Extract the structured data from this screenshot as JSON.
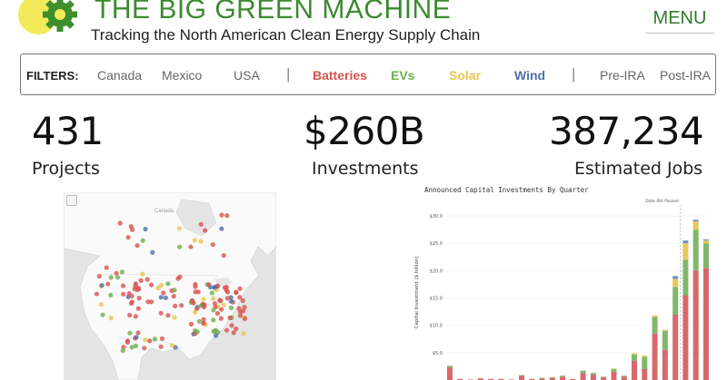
{
  "brand": {
    "title": "THE BIG GREEN MACHINE",
    "tagline": "Tracking the North American Clean Energy Supply Chain",
    "logo_icon": "gear-leaf-icon",
    "logo_colors": {
      "sun": "#f2ea5a",
      "gear": "#3e8f2c"
    }
  },
  "menu": {
    "label": "MENU"
  },
  "filters": {
    "label": "FILTERS:",
    "regions": [
      "Canada",
      "Mexico",
      "USA"
    ],
    "sectors": [
      {
        "label": "Batteries",
        "color": "#d9534f"
      },
      {
        "label": "EVs",
        "color": "#6ab04c"
      },
      {
        "label": "Solar",
        "color": "#eac651"
      },
      {
        "label": "Wind",
        "color": "#4f6fa8"
      }
    ],
    "periods": [
      "Pre-IRA",
      "Post-IRA"
    ],
    "separator": "|"
  },
  "stats": [
    {
      "value": "431",
      "label": "Projects"
    },
    {
      "value": "$260B",
      "label": "Investments"
    },
    {
      "value": "387,234",
      "label": "Estimated Jobs"
    }
  ],
  "map": {
    "region_label": "Canada",
    "zoom_icon": "search-icon"
  },
  "chart_data": {
    "type": "bar",
    "title": "Announced Capital Investments By Quarter",
    "ylabel": "Capital Investment ($ billion)",
    "y_ticks": [
      "$30.0",
      "$25.0",
      "$20.0",
      "$15.0",
      "$10.0",
      "$5.0"
    ],
    "ylim": [
      0,
      32
    ],
    "annotation": "Date IRA Passed",
    "stacked": true,
    "series": [
      {
        "name": "Batteries",
        "color": "#d9686a"
      },
      {
        "name": "EVs",
        "color": "#7fb86a"
      },
      {
        "name": "Solar",
        "color": "#e8c85a"
      },
      {
        "name": "Wind",
        "color": "#6a8fc0"
      }
    ],
    "bars": [
      {
        "q": 1,
        "values": [
          2.3,
          0.3,
          0,
          0
        ]
      },
      {
        "q": 2,
        "values": [
          0.2,
          0,
          0,
          0
        ]
      },
      {
        "q": 3,
        "values": [
          0.1,
          0,
          0,
          0
        ]
      },
      {
        "q": 4,
        "values": [
          0.3,
          0,
          0,
          0
        ]
      },
      {
        "q": 5,
        "values": [
          0.2,
          0,
          0,
          0
        ]
      },
      {
        "q": 6,
        "values": [
          0.2,
          0,
          0,
          0
        ]
      },
      {
        "q": 7,
        "values": [
          0.1,
          0,
          0,
          0
        ]
      },
      {
        "q": 8,
        "values": [
          0.8,
          0.1,
          0,
          0
        ]
      },
      {
        "q": 9,
        "values": [
          0.2,
          0,
          0,
          0
        ]
      },
      {
        "q": 10,
        "values": [
          0.3,
          0.1,
          0,
          0
        ]
      },
      {
        "q": 11,
        "values": [
          0.4,
          0.1,
          0,
          0
        ]
      },
      {
        "q": 12,
        "values": [
          0.6,
          0.2,
          0,
          0
        ]
      },
      {
        "q": 13,
        "values": [
          0.2,
          0,
          0,
          0
        ]
      },
      {
        "q": 14,
        "values": [
          1.3,
          0.4,
          0,
          0
        ]
      },
      {
        "q": 15,
        "values": [
          1.0,
          0.3,
          0,
          0
        ]
      },
      {
        "q": 16,
        "values": [
          0.5,
          0.1,
          0,
          0
        ]
      },
      {
        "q": 17,
        "values": [
          1.5,
          0.5,
          0.1,
          0
        ]
      },
      {
        "q": 18,
        "values": [
          0.6,
          0.2,
          0,
          0
        ]
      },
      {
        "q": 19,
        "values": [
          3.5,
          1.2,
          0.2,
          0
        ]
      },
      {
        "q": 20,
        "values": [
          2.0,
          2.2,
          0.3,
          0
        ]
      },
      {
        "q": 21,
        "values": [
          8.5,
          3.0,
          0.3,
          0
        ]
      },
      {
        "q": 22,
        "values": [
          5.5,
          3.5,
          0.2,
          0
        ]
      },
      {
        "q": 23,
        "values": [
          12.0,
          5.0,
          1.5,
          0.5
        ]
      },
      {
        "q": 24,
        "values": [
          15.5,
          6.5,
          3.0,
          0.5
        ]
      },
      {
        "q": 25,
        "values": [
          20.0,
          7.5,
          1.5,
          0.3
        ]
      },
      {
        "q": 26,
        "values": [
          20.5,
          4.5,
          0.5,
          0.2
        ]
      }
    ]
  }
}
